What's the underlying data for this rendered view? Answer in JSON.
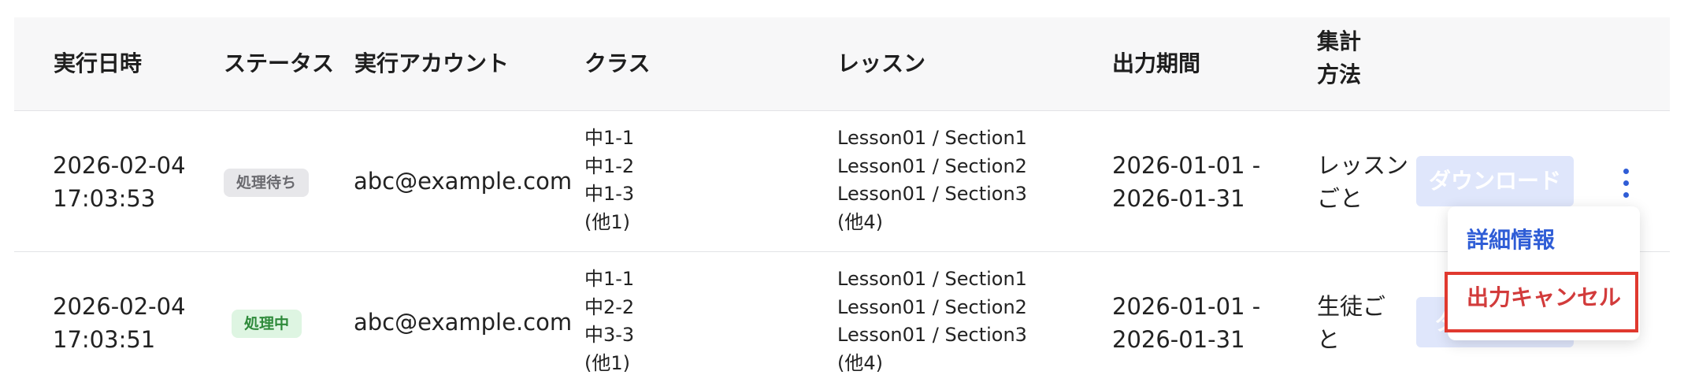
{
  "table": {
    "headers": {
      "executed_at": "実行日時",
      "status": "ステータス",
      "account": "実行アカウント",
      "class": "クラス",
      "lesson": "レッスン",
      "period": "出力期間",
      "method_line1": "集計",
      "method_line2": "方法"
    },
    "rows": [
      {
        "date": "2026-02-04",
        "time": "17:03:53",
        "status": "処理待ち",
        "account": "abc@example.com",
        "classes": [
          "中1-1",
          "中1-2",
          "中1-3",
          "(他1)"
        ],
        "lessons": [
          "Lesson01 / Section1",
          "Lesson01 / Section2",
          "Lesson01 / Section3",
          "(他4)"
        ],
        "period_start": "2026-01-01 -",
        "period_end": "2026-01-31",
        "method_line1": "レッスン",
        "method_line2": "ごと",
        "download_label": "ダウンロード"
      },
      {
        "date": "2026-02-04",
        "time": "17:03:51",
        "status": "処理中",
        "account": "abc@example.com",
        "classes": [
          "中1-1",
          "中2-2",
          "中3-3",
          "(他1)"
        ],
        "lessons": [
          "Lesson01 / Section1",
          "Lesson01 / Section2",
          "Lesson01 / Section3",
          "(他4)"
        ],
        "period_start": "2026-01-01 -",
        "period_end": "2026-01-31",
        "method_line1": "生徒ご",
        "method_line2": "と",
        "download_label": "ダ"
      }
    ]
  },
  "menu": {
    "detail_label": "詳細情報",
    "cancel_label": "出力キャンセル"
  },
  "colors": {
    "accent": "#2f5dd6",
    "danger": "#d23b3b",
    "highlight": "#e0392f",
    "header_bg": "#f7f7f8",
    "download_disabled": "#dfe6fb"
  }
}
